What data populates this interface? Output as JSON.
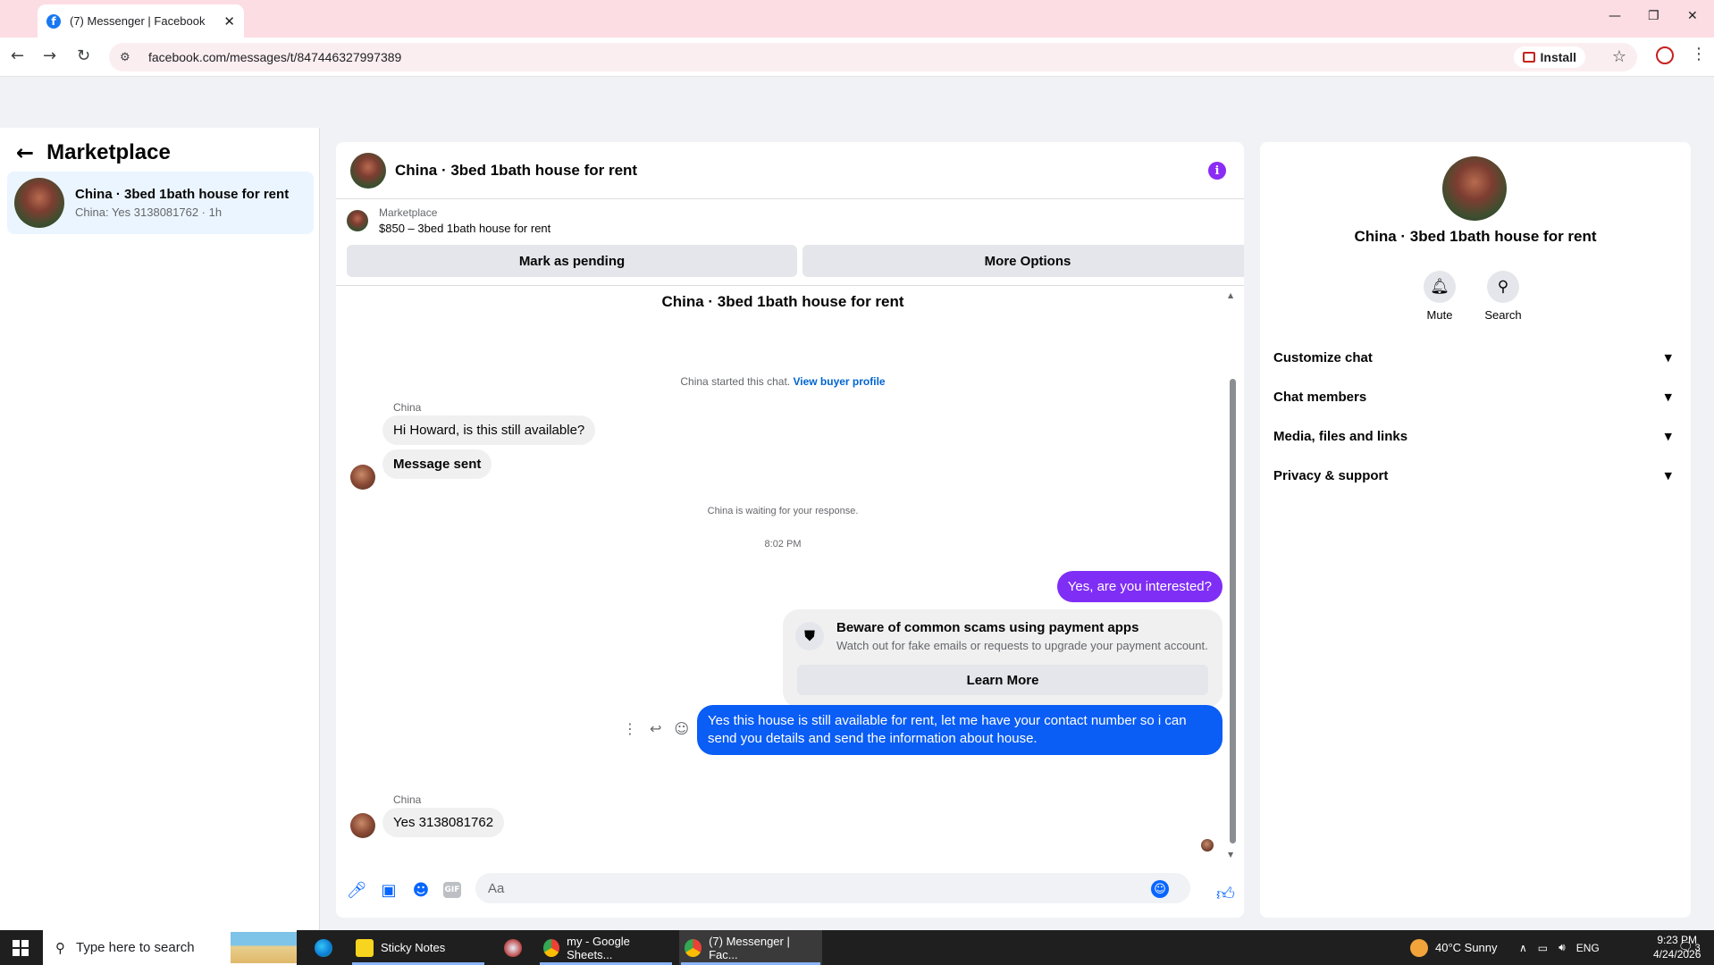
{
  "browser": {
    "tab_title": "(7) Messenger | Facebook",
    "tab_close": "✕",
    "url": "facebook.com/messages/t/847446327997389",
    "install_label": "Install",
    "window_controls": {
      "minimize": "—",
      "restore": "❐",
      "close": "✕"
    },
    "nav": {
      "back": "←",
      "forward": "→",
      "reload": "↻"
    }
  },
  "sidebar": {
    "title": "Marketplace",
    "back_icon": "←",
    "conversation": {
      "name": "China · 3bed 1bath house for rent",
      "preview": "China: Yes 3138081762 · 1h"
    }
  },
  "chat": {
    "header_title": "China · 3bed 1bath house for rent",
    "listing_label": "Marketplace",
    "listing_title": "$850 – 3bed 1bath house for rent",
    "mark_pending_label": "Mark as pending",
    "more_options_label": "More Options",
    "thread_title": "China · 3bed 1bath house for rent",
    "started_text": "China started this chat.",
    "view_buyer_label": "View buyer profile",
    "sender_name_1": "China",
    "msg_1": "Hi Howard, is this still available?",
    "msg_2": "Message sent",
    "waiting_text": "China is waiting for your response.",
    "timestamp": "8:02 PM",
    "out_msg_1": "Yes, are you interested?",
    "scam_title": "Beware of common scams using payment apps",
    "scam_desc": "Watch out for fake emails or requests to upgrade your payment account.",
    "learn_more_label": "Learn More",
    "out_msg_2": "Yes this house is still available for rent, let me have your contact number so i can send you details and send the information about house.",
    "sender_name_2": "China",
    "msg_3": "Yes 3138081762",
    "composer_placeholder": "Aa",
    "gif_label": "GIF"
  },
  "details": {
    "title": "China · 3bed 1bath house for rent",
    "mute_label": "Mute",
    "search_label": "Search",
    "sections": [
      {
        "label": "Customize chat"
      },
      {
        "label": "Chat members"
      },
      {
        "label": "Media, files and links"
      },
      {
        "label": "Privacy & support"
      }
    ]
  },
  "taskbar": {
    "search_placeholder": "Type here to search",
    "apps": [
      {
        "label": "Sticky Notes"
      },
      {
        "label": "my - Google Sheets..."
      },
      {
        "label": "(7) Messenger | Fac..."
      }
    ],
    "weather": "40°C  Sunny",
    "language": "ENG",
    "time": "9:23 PM",
    "date": "4/24/2026",
    "notifications": "3"
  },
  "colors": {
    "accent_blue": "#0a5df5",
    "accent_purple": "#7f2ef5",
    "tab_strip": "#fcdde3"
  }
}
